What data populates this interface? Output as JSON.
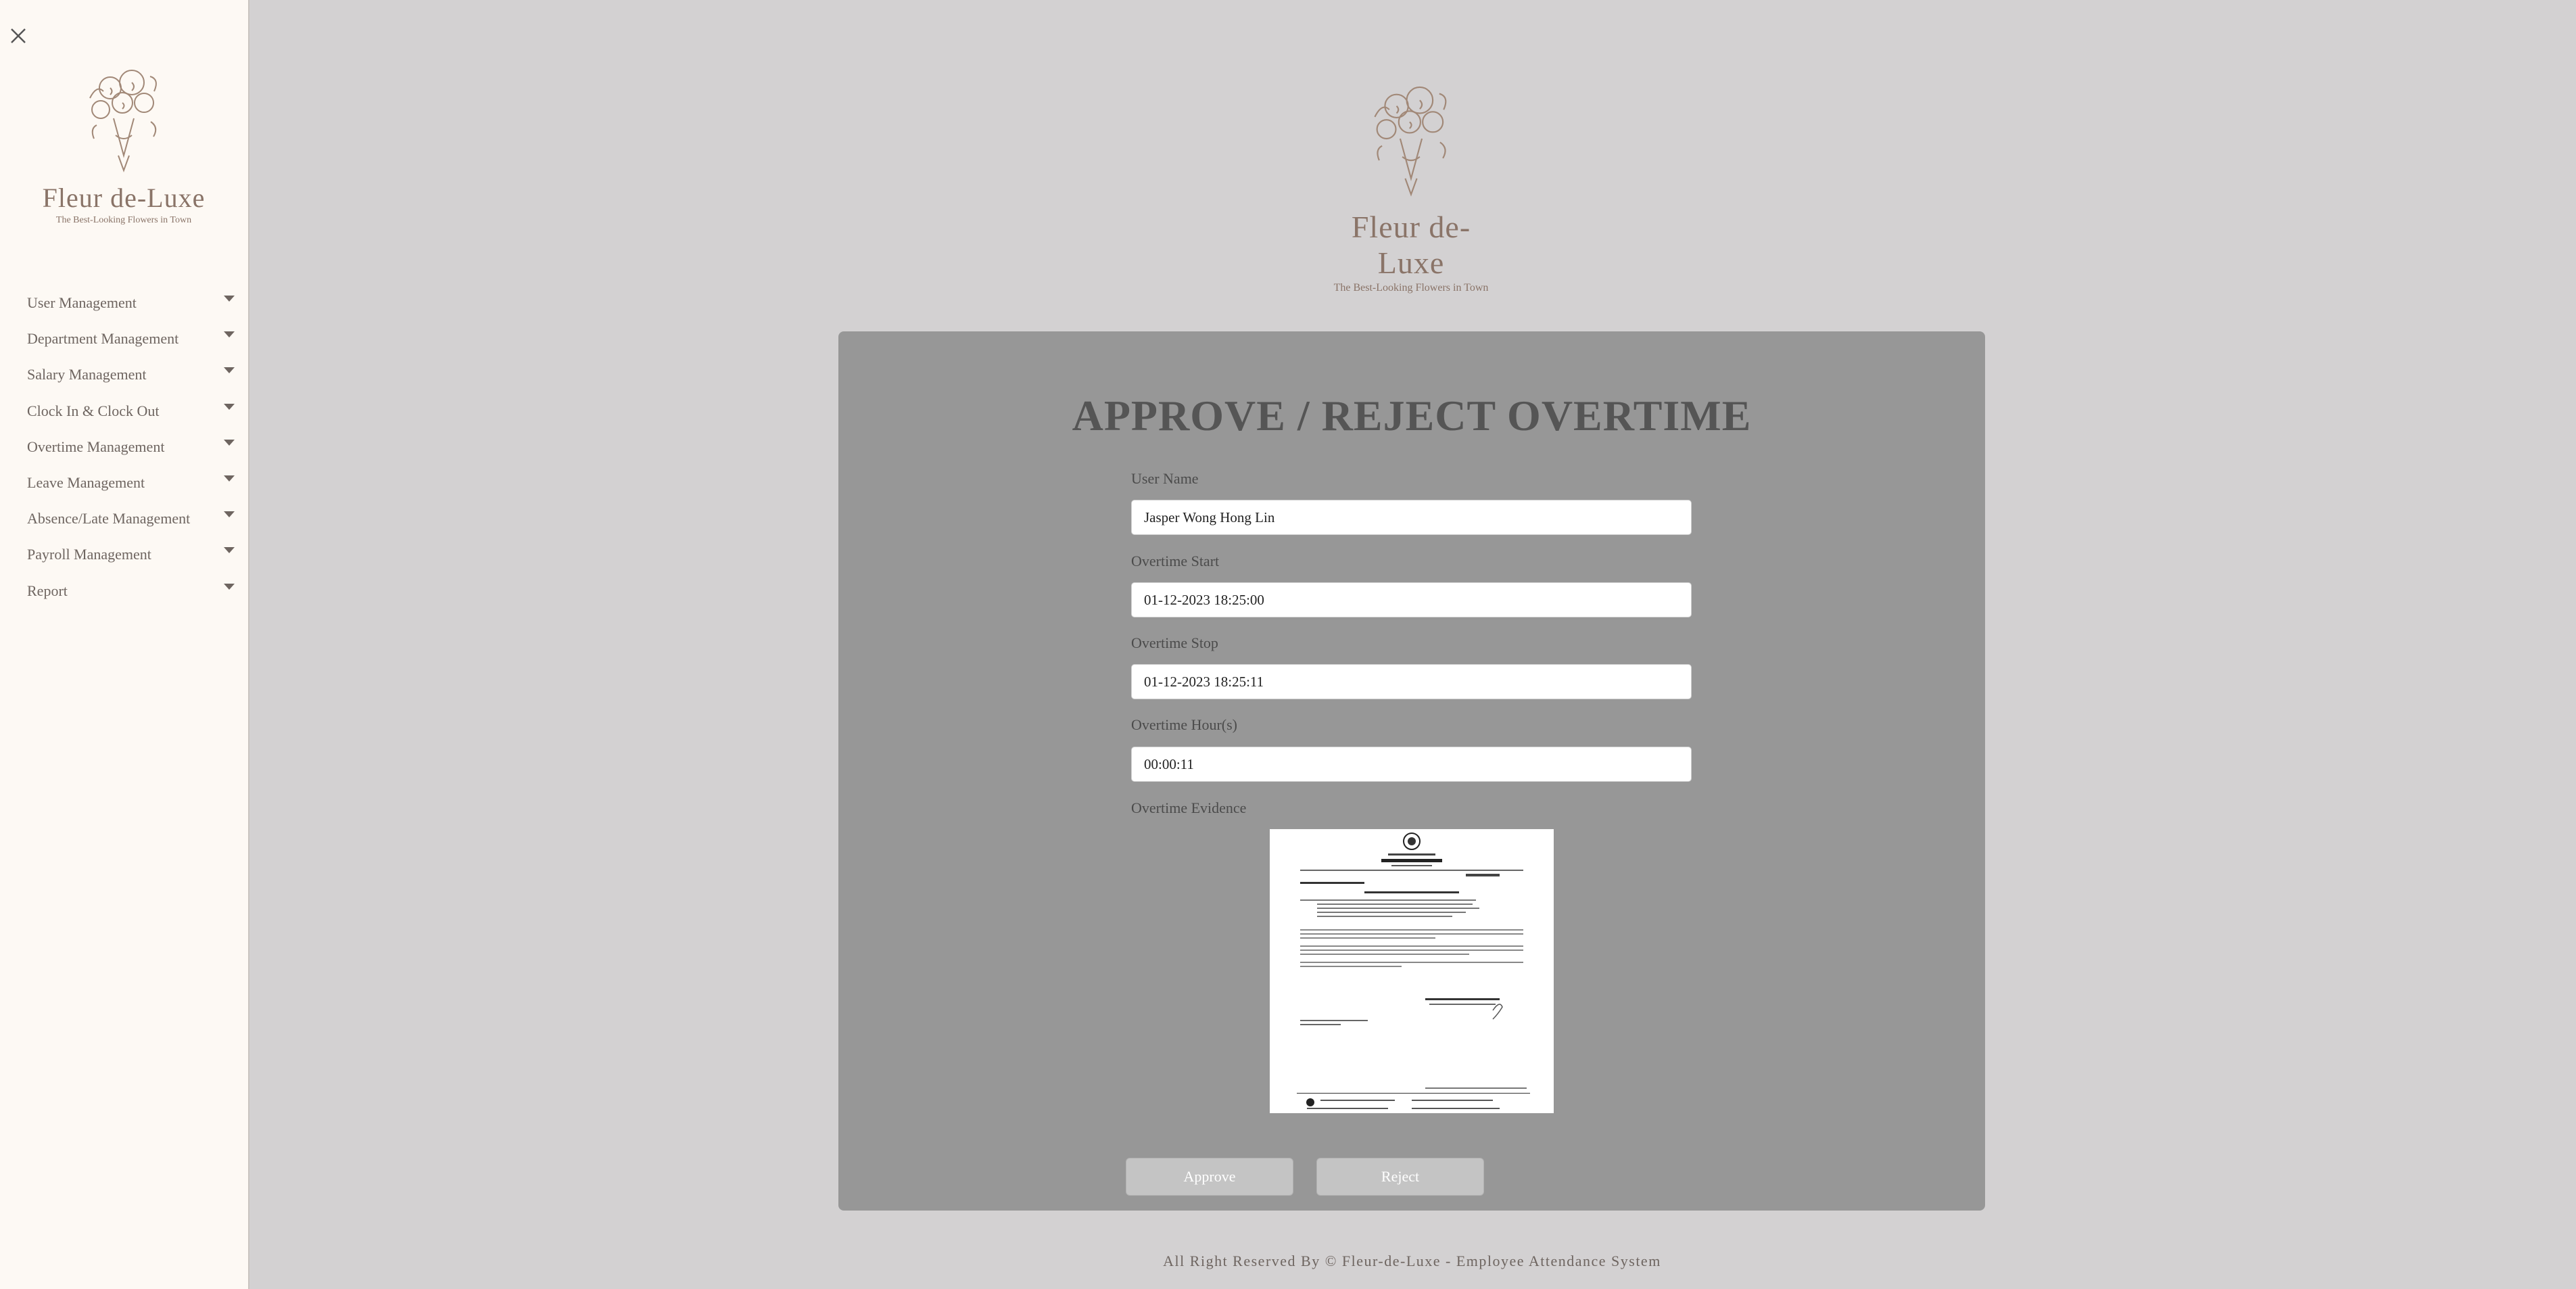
{
  "brand": {
    "name": "Fleur de-Luxe",
    "tagline": "The Best-Looking Flowers in Town"
  },
  "sidebar": {
    "items": [
      {
        "label": "User Management"
      },
      {
        "label": "Department Management"
      },
      {
        "label": "Salary Management"
      },
      {
        "label": "Clock In & Clock Out"
      },
      {
        "label": "Overtime Management"
      },
      {
        "label": "Leave Management"
      },
      {
        "label": "Absence/Late Management"
      },
      {
        "label": "Payroll Management"
      },
      {
        "label": "Report"
      }
    ]
  },
  "form": {
    "title": "APPROVE / REJECT OVERTIME",
    "user_name_label": "User Name",
    "user_name_value": "Jasper Wong Hong Lin",
    "start_label": "Overtime Start",
    "start_value": "01-12-2023 18:25:00",
    "stop_label": "Overtime Stop",
    "stop_value": "01-12-2023 18:25:11",
    "hours_label": "Overtime Hour(s)",
    "hours_value": "00:00:11",
    "evidence_label": "Overtime Evidence",
    "approve_label": "Approve",
    "reject_label": "Reject"
  },
  "footer": {
    "text": "All Right Reserved By © Fleur-de-Luxe - Employee Attendance System"
  }
}
